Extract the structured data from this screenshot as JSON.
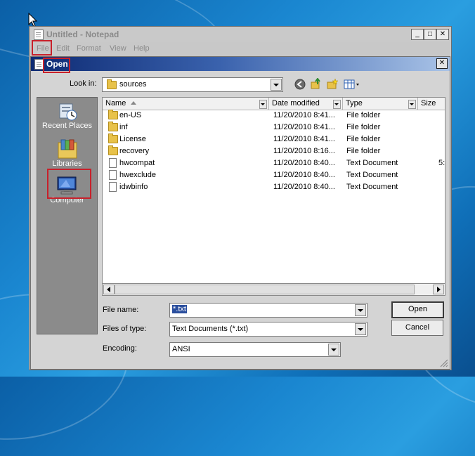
{
  "notepad": {
    "title": "Untitled - Notepad",
    "window_buttons": {
      "minimize": "_",
      "maximize": "□",
      "close": "✕"
    },
    "menu": [
      "File",
      "Edit",
      "Format",
      "View",
      "Help"
    ]
  },
  "dialog": {
    "title": "Open",
    "close_glyph": "✕",
    "look_in_label": "Look in:",
    "look_in_value": "sources",
    "places": [
      {
        "label": "Recent Places",
        "icon": "recent-places-icon"
      },
      {
        "label": "Libraries",
        "icon": "libraries-icon"
      },
      {
        "label": "Computer",
        "icon": "computer-icon"
      }
    ],
    "columns": [
      "Name",
      "Date modified",
      "Type",
      "Size"
    ],
    "files": [
      {
        "name": "en-US",
        "date": "11/20/2010 8:41...",
        "type": "File folder",
        "size": "",
        "icon": "folder-icon"
      },
      {
        "name": "inf",
        "date": "11/20/2010 8:41...",
        "type": "File folder",
        "size": "",
        "icon": "folder-icon"
      },
      {
        "name": "License",
        "date": "11/20/2010 8:41...",
        "type": "File folder",
        "size": "",
        "icon": "folder-icon"
      },
      {
        "name": "recovery",
        "date": "11/20/2010 8:16...",
        "type": "File folder",
        "size": "",
        "icon": "folder-icon"
      },
      {
        "name": "hwcompat",
        "date": "11/20/2010 8:40...",
        "type": "Text Document",
        "size": "5:",
        "icon": "text-file-icon"
      },
      {
        "name": "hwexclude",
        "date": "11/20/2010 8:40...",
        "type": "Text Document",
        "size": "",
        "icon": "text-file-icon"
      },
      {
        "name": "idwbinfo",
        "date": "11/20/2010 8:40...",
        "type": "Text Document",
        "size": "",
        "icon": "text-file-icon"
      }
    ],
    "file_name_label": "File name:",
    "file_name_value": "*.txt",
    "files_of_type_label": "Files of type:",
    "files_of_type_value": "Text Documents (*.txt)",
    "encoding_label": "Encoding:",
    "encoding_value": "ANSI",
    "open_button": "Open",
    "cancel_button": "Cancel"
  },
  "colors": {
    "highlight_box": "#c8202a",
    "title_bar_dark": "#0d2a73"
  }
}
